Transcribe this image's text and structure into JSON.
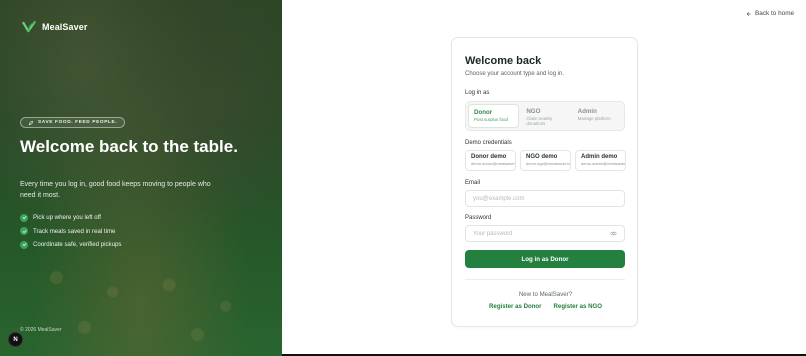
{
  "hero": {
    "brand": "MealSaver",
    "tagline": "SAVE FOOD. FEED PEOPLE.",
    "headline": "Welcome back to the table.",
    "lead": "Every time you log in, good food keeps moving to people who need it most.",
    "checks": [
      "Pick up where you left off",
      "Track meals saved in real time",
      "Coordinate safe, verified pickups"
    ],
    "copyright": "© 2026 MealSaver",
    "badge": "N"
  },
  "nav": {
    "back": "Back to home"
  },
  "card": {
    "title": "Welcome back",
    "subtitle": "Choose your account type and log in.",
    "login_as_label": "Log in as",
    "roles": [
      {
        "title": "Donor",
        "sub": "Post surplus food",
        "active": true
      },
      {
        "title": "NGO",
        "sub": "Claim nearby donations",
        "active": false
      },
      {
        "title": "Admin",
        "sub": "Manage platform",
        "active": false
      }
    ],
    "demo_label": "Demo credentials",
    "demos": [
      {
        "title": "Donor demo",
        "email": "demo.donor@mealsaver.local"
      },
      {
        "title": "NGO demo",
        "email": "demo.ngo@mealsaver.local"
      },
      {
        "title": "Admin demo",
        "email": "demo.admin@mealsaver.local"
      }
    ],
    "email_label": "Email",
    "email_placeholder": "you@example.com",
    "password_label": "Password",
    "password_placeholder": "Your password",
    "submit": "Log in as Donor",
    "new_to": "New to MealSaver?",
    "register_donor": "Register as Donor",
    "register_ngo": "Register as NGO"
  },
  "colors": {
    "accent": "#24803f",
    "accent_light": "#3aa458"
  }
}
